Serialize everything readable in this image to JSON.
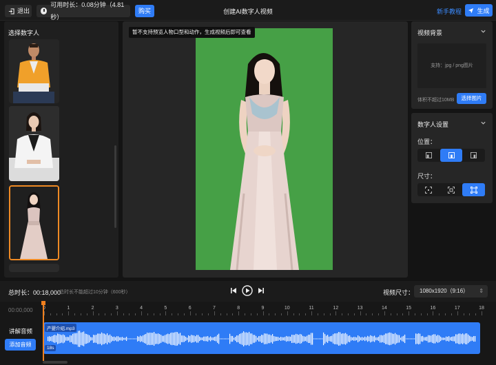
{
  "header": {
    "exit_label": "退出",
    "available_time": "可用时长：0.08分钟（4.81秒）",
    "buy_label": "购买",
    "title": "创建AI数字人视频",
    "tutorial_label": "新手教程",
    "generate_label": "生成"
  },
  "left_panel": {
    "title": "选择数字人",
    "avatars": [
      {
        "name": "man-orange-shirt",
        "selected": false
      },
      {
        "name": "woman-white-suit",
        "selected": false
      },
      {
        "name": "woman-satin-gown",
        "selected": true
      }
    ]
  },
  "preview": {
    "notice": "暂不支持预览人物口型和动作，生成视频后即可查看",
    "background_color": "#46a046"
  },
  "background_panel": {
    "title": "视频背景",
    "upload_hint": "支持：jpg / png图片",
    "size_limit": "体积不超过10MB",
    "choose_label": "选择图片"
  },
  "avatar_settings": {
    "title": "数字人设置",
    "position_label": "位置：",
    "size_label": "尺寸：",
    "position_options": [
      "left",
      "center",
      "right"
    ],
    "position_selected": "center",
    "size_options": [
      "small",
      "medium",
      "large"
    ],
    "size_selected": "large"
  },
  "controls": {
    "total_duration": "总时长：00:18,000",
    "duration_hint": "总时长不能超过10分钟（600秒）",
    "video_size_label": "视频尺寸：",
    "video_size_value": "1080x1920（9:16）"
  },
  "timeline": {
    "current_time": "00:00,000",
    "ticks": [
      "0",
      "1",
      "2",
      "3",
      "4",
      "5",
      "6",
      "7",
      "8",
      "9",
      "10",
      "11",
      "12",
      "13",
      "14",
      "15",
      "16",
      "17",
      "18"
    ],
    "track_label": "讲解音频",
    "add_audio_label": "添加音频",
    "clip_name": "产婴介绍.mp3",
    "clip_duration": "18s"
  },
  "colors": {
    "accent": "#2f7cf6",
    "selection": "#f08a24",
    "green_screen": "#46a046"
  }
}
